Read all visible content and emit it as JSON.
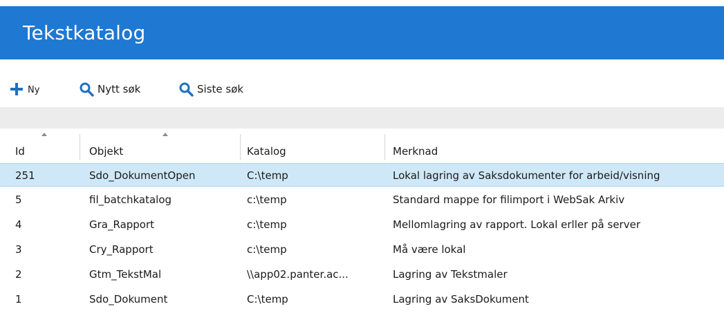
{
  "header": {
    "title": "Tekstkatalog"
  },
  "toolbar": {
    "new_label": "Ny",
    "new_search_label": "Nytt søk",
    "last_search_label": "Siste søk"
  },
  "colors": {
    "header_bg": "#1f78d1",
    "icon_blue": "#1f6fc0",
    "selected_row": "#cfe8f7"
  },
  "grid": {
    "columns": [
      "Id",
      "Objekt",
      "Katalog",
      "Merknad"
    ],
    "sorted_columns": [
      "Id",
      "Objekt"
    ],
    "selected_row_index": 0,
    "rows": [
      {
        "id": "251",
        "objekt": "Sdo_DokumentOpen",
        "katalog": "C:\\temp",
        "merknad": "Lokal lagring av Saksdokumenter for arbeid/visning"
      },
      {
        "id": "5",
        "objekt": "fil_batchkatalog",
        "katalog": "c:\\temp",
        "merknad": "Standard mappe for filimport i WebSak Arkiv"
      },
      {
        "id": "4",
        "objekt": "Gra_Rapport",
        "katalog": "c:\\temp",
        "merknad": "Mellomlagring av rapport. Lokal erller på server"
      },
      {
        "id": "3",
        "objekt": "Cry_Rapport",
        "katalog": "c:\\temp",
        "merknad": "Må være lokal"
      },
      {
        "id": "2",
        "objekt": "Gtm_TekstMal",
        "katalog": "\\\\app02.panter.ac...",
        "merknad": "Lagring av Tekstmaler"
      },
      {
        "id": "1",
        "objekt": "Sdo_Dokument",
        "katalog": "C:\\temp",
        "merknad": "Lagring av SaksDokument"
      }
    ]
  }
}
